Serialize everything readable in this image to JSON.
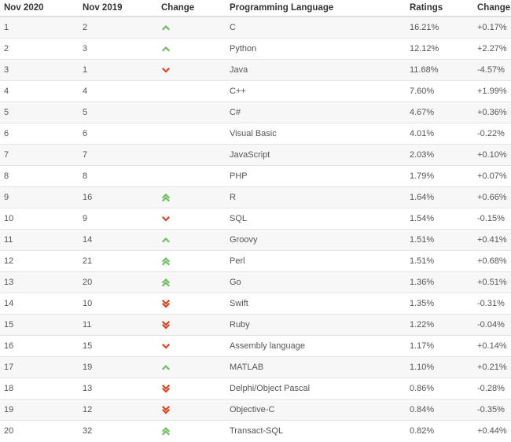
{
  "colors": {
    "up": "#6bbf5f",
    "down": "#e0421e"
  },
  "headers": [
    "Nov 2020",
    "Nov 2019",
    "Change",
    "Programming Language",
    "Ratings",
    "Change"
  ],
  "rows": [
    {
      "rank_2020": "1",
      "rank_2019": "2",
      "trend": "up",
      "language": "C",
      "rating": "16.21%",
      "change": "+0.17%"
    },
    {
      "rank_2020": "2",
      "rank_2019": "3",
      "trend": "up",
      "language": "Python",
      "rating": "12.12%",
      "change": "+2.27%"
    },
    {
      "rank_2020": "3",
      "rank_2019": "1",
      "trend": "down",
      "language": "Java",
      "rating": "11.68%",
      "change": "-4.57%"
    },
    {
      "rank_2020": "4",
      "rank_2019": "4",
      "trend": "none",
      "language": "C++",
      "rating": "7.60%",
      "change": "+1.99%"
    },
    {
      "rank_2020": "5",
      "rank_2019": "5",
      "trend": "none",
      "language": "C#",
      "rating": "4.67%",
      "change": "+0.36%"
    },
    {
      "rank_2020": "6",
      "rank_2019": "6",
      "trend": "none",
      "language": "Visual Basic",
      "rating": "4.01%",
      "change": "-0.22%"
    },
    {
      "rank_2020": "7",
      "rank_2019": "7",
      "trend": "none",
      "language": "JavaScript",
      "rating": "2.03%",
      "change": "+0.10%"
    },
    {
      "rank_2020": "8",
      "rank_2019": "8",
      "trend": "none",
      "language": "PHP",
      "rating": "1.79%",
      "change": "+0.07%"
    },
    {
      "rank_2020": "9",
      "rank_2019": "16",
      "trend": "up2",
      "language": "R",
      "rating": "1.64%",
      "change": "+0.66%"
    },
    {
      "rank_2020": "10",
      "rank_2019": "9",
      "trend": "down",
      "language": "SQL",
      "rating": "1.54%",
      "change": "-0.15%"
    },
    {
      "rank_2020": "11",
      "rank_2019": "14",
      "trend": "up",
      "language": "Groovy",
      "rating": "1.51%",
      "change": "+0.41%"
    },
    {
      "rank_2020": "12",
      "rank_2019": "21",
      "trend": "up2",
      "language": "Perl",
      "rating": "1.51%",
      "change": "+0.68%"
    },
    {
      "rank_2020": "13",
      "rank_2019": "20",
      "trend": "up2",
      "language": "Go",
      "rating": "1.36%",
      "change": "+0.51%"
    },
    {
      "rank_2020": "14",
      "rank_2019": "10",
      "trend": "down2",
      "language": "Swift",
      "rating": "1.35%",
      "change": "-0.31%"
    },
    {
      "rank_2020": "15",
      "rank_2019": "11",
      "trend": "down2",
      "language": "Ruby",
      "rating": "1.22%",
      "change": "-0.04%"
    },
    {
      "rank_2020": "16",
      "rank_2019": "15",
      "trend": "down",
      "language": "Assembly language",
      "rating": "1.17%",
      "change": "+0.14%"
    },
    {
      "rank_2020": "17",
      "rank_2019": "19",
      "trend": "up",
      "language": "MATLAB",
      "rating": "1.10%",
      "change": "+0.21%"
    },
    {
      "rank_2020": "18",
      "rank_2019": "13",
      "trend": "down2",
      "language": "Delphi/Object Pascal",
      "rating": "0.86%",
      "change": "-0.28%"
    },
    {
      "rank_2020": "19",
      "rank_2019": "12",
      "trend": "down2",
      "language": "Objective-C",
      "rating": "0.84%",
      "change": "-0.35%"
    },
    {
      "rank_2020": "20",
      "rank_2019": "32",
      "trend": "up2",
      "language": "Transact-SQL",
      "rating": "0.82%",
      "change": "+0.44%"
    }
  ]
}
